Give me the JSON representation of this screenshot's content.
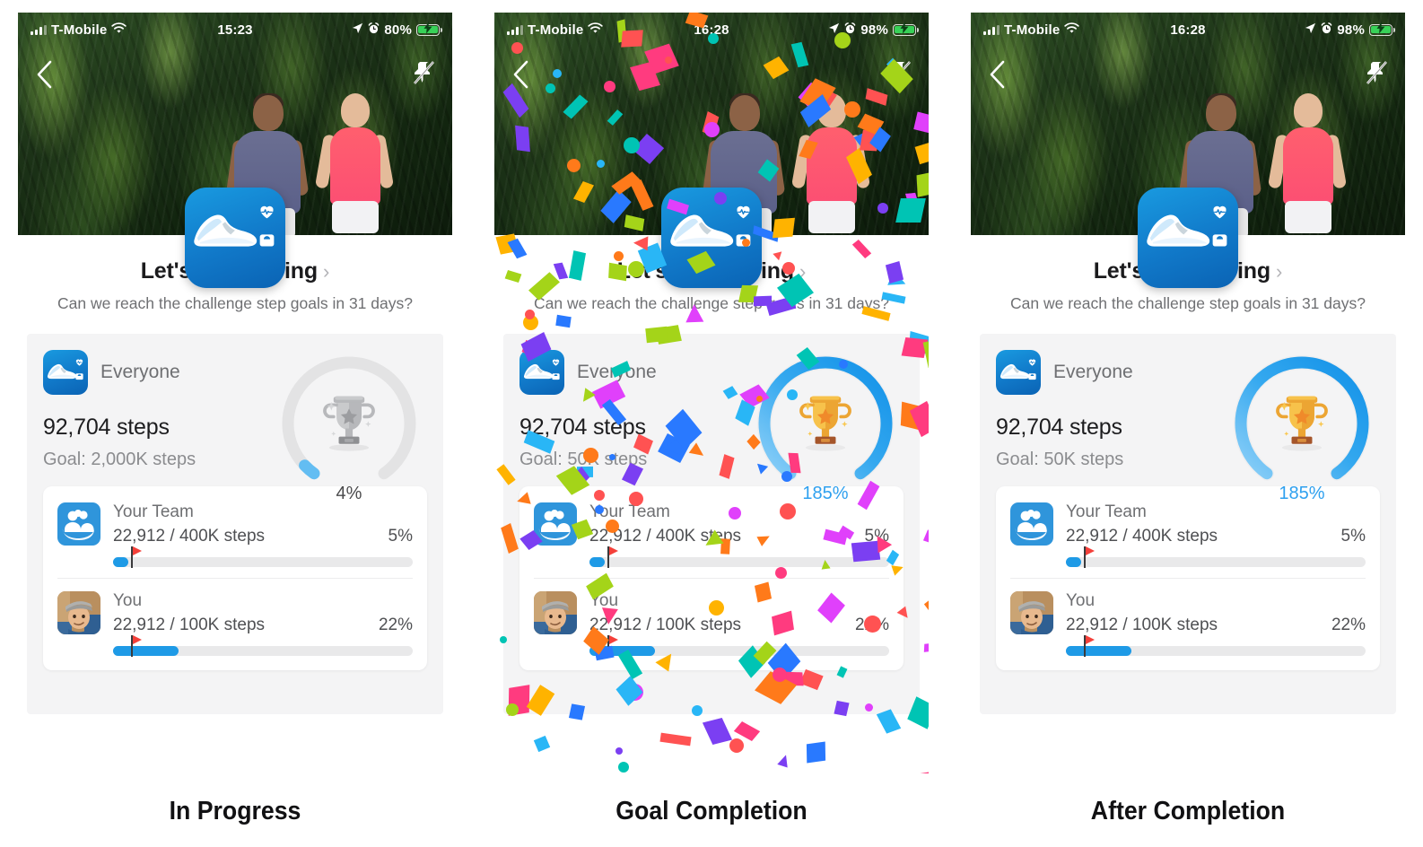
{
  "panels": [
    {
      "caption": "In Progress",
      "confetti": false,
      "status": {
        "carrier": "T-Mobile",
        "time": "15:23",
        "battery_pct": "80%",
        "icons": [
          "signal-bars-icon",
          "wifi-icon",
          "location-arrow-icon",
          "alarm-clock-icon",
          "battery-charging-icon"
        ]
      },
      "nav": {
        "back": "back-chevron-icon",
        "pin": "unpin-icon"
      },
      "challenge": {
        "title": "Let's Get Moving",
        "chevron": "›",
        "subtitle": "Can we reach the challenge step goals in 31 days?",
        "icon": "running-shoe-app-icon"
      },
      "everyone": {
        "label": "Everyone",
        "steps": "92,704 steps",
        "goal": "Goal: 2,000K steps",
        "percent_label": "4%",
        "percent_value": 4,
        "ring_state": "incomplete",
        "trophy": "gray-trophy-icon"
      },
      "members": [
        {
          "avatar": "team-group-icon",
          "name": "Your Team",
          "steps": "22,912 / 400K steps",
          "percent_label": "5%",
          "percent_value": 5,
          "flag_value": 6
        },
        {
          "avatar": "user-photo-avatar",
          "name": "You",
          "steps": "22,912 / 100K steps",
          "percent_label": "22%",
          "percent_value": 22,
          "flag_value": 6
        }
      ]
    },
    {
      "caption": "Goal Completion",
      "confetti": true,
      "status": {
        "carrier": "T-Mobile",
        "time": "16:28",
        "battery_pct": "98%",
        "icons": [
          "signal-bars-icon",
          "wifi-icon",
          "location-arrow-icon",
          "alarm-clock-icon",
          "battery-charging-icon"
        ]
      },
      "nav": {
        "back": "back-chevron-icon",
        "pin": "unpin-icon"
      },
      "challenge": {
        "title": "Let's Get Moving",
        "chevron": "›",
        "subtitle": "Can we reach the challenge step goals in 31 days?",
        "icon": "running-shoe-app-icon"
      },
      "everyone": {
        "label": "Everyone",
        "steps": "92,704 steps",
        "goal": "Goal: 50K steps",
        "percent_label": "185%",
        "percent_value": 185,
        "ring_state": "complete",
        "trophy": "gold-trophy-icon"
      },
      "members": [
        {
          "avatar": "team-group-icon",
          "name": "Your Team",
          "steps": "22,912 / 400K steps",
          "percent_label": "5%",
          "percent_value": 5,
          "flag_value": 6
        },
        {
          "avatar": "user-photo-avatar",
          "name": "You",
          "steps": "22,912 / 100K steps",
          "percent_label": "22%",
          "percent_value": 22,
          "flag_value": 6
        }
      ]
    },
    {
      "caption": "After Completion",
      "confetti": false,
      "status": {
        "carrier": "T-Mobile",
        "time": "16:28",
        "battery_pct": "98%",
        "icons": [
          "signal-bars-icon",
          "wifi-icon",
          "location-arrow-icon",
          "alarm-clock-icon",
          "battery-charging-icon"
        ]
      },
      "nav": {
        "back": "back-chevron-icon",
        "pin": "unpin-icon"
      },
      "challenge": {
        "title": "Let's Get Moving",
        "chevron": "›",
        "subtitle": "Can we reach the challenge step goals in 31 days?",
        "icon": "running-shoe-app-icon"
      },
      "everyone": {
        "label": "Everyone",
        "steps": "92,704 steps",
        "goal": "Goal: 50K steps",
        "percent_label": "185%",
        "percent_value": 185,
        "ring_state": "complete",
        "trophy": "gold-trophy-icon"
      },
      "members": [
        {
          "avatar": "team-group-icon",
          "name": "Your Team",
          "steps": "22,912 / 400K steps",
          "percent_label": "5%",
          "percent_value": 5,
          "flag_value": 6
        },
        {
          "avatar": "user-photo-avatar",
          "name": "You",
          "steps": "22,912 / 100K steps",
          "percent_label": "22%",
          "percent_value": 22,
          "flag_value": 6
        }
      ]
    }
  ],
  "colors": {
    "accent_blue": "#1e9ae6",
    "ring_blue_light": "#6cc3f5",
    "ring_gray": "#e3e3e4",
    "flag_red": "#f4403a",
    "battery_green": "#38d158",
    "card_bg": "#f4f4f5",
    "gold": "#f5b335"
  },
  "confetti_colors": [
    "#ff3b7f",
    "#7b3ff2",
    "#ff7a1a",
    "#29b6f6",
    "#a4d419",
    "#ffb300",
    "#e040fb",
    "#2979ff",
    "#ff5252",
    "#00c4b4"
  ]
}
